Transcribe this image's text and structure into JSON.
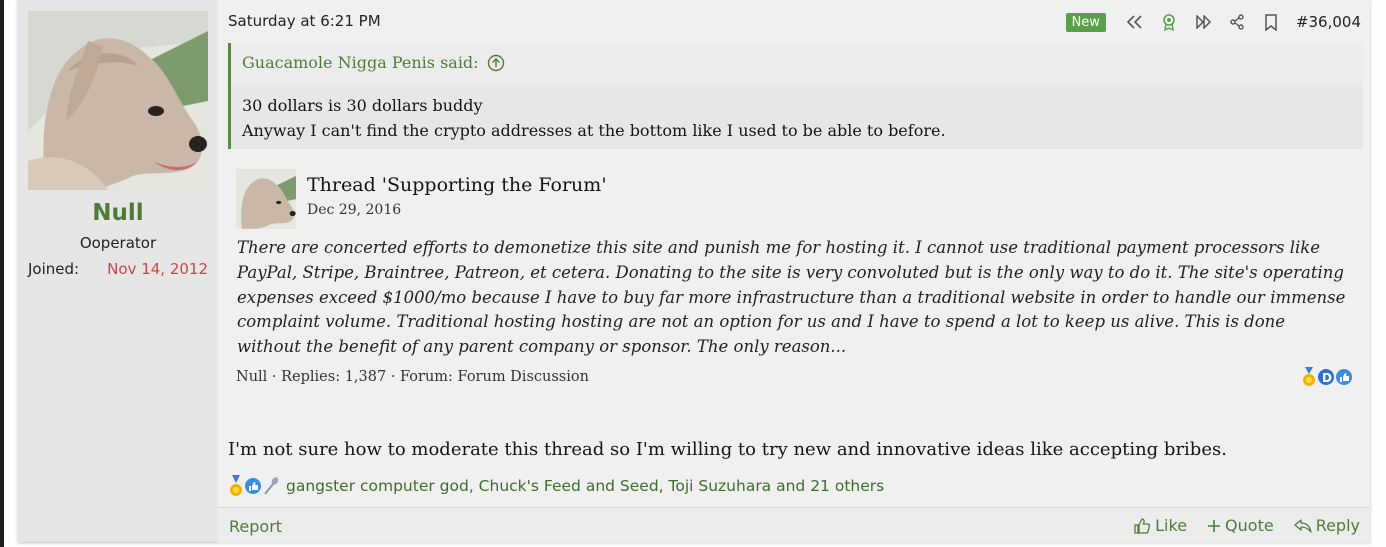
{
  "post": {
    "user": {
      "name": "Null",
      "title": "Ooperator",
      "joined_label": "Joined:",
      "joined_value": "Nov 14, 2012"
    },
    "header": {
      "date": "Saturday at 6:21 PM",
      "new_badge": "New",
      "post_number": "#36,004",
      "icons": [
        "rewind-icon",
        "award-icon",
        "fast-forward-icon",
        "share-icon",
        "bookmark-icon"
      ]
    },
    "quote": {
      "author": "Guacamole Nigga Penis said:",
      "lines": [
        "30 dollars is 30 dollars buddy",
        "Anyway I can't find the crypto addresses at the bottom like I used to be able to before."
      ]
    },
    "unfurl": {
      "title": "Thread 'Supporting the Forum'",
      "date": "Dec 29, 2016",
      "excerpt": "There are concerted efforts to demonetize this site and punish me for hosting it. I cannot use traditional payment processors like PayPal, Stripe, Braintree, Patreon, et cetera. Donating to the site is very convoluted but is the only way to do it. The site's operating expenses exceed $1000/mo because I have to buy far more infrastructure than a traditional website in order to handle our immense complaint volume. Traditional hosting hosting are not an option for us and I have to spend a lot to keep us alive. This is done without the benefit of any parent company or sponsor. The only reason...",
      "meta": "Null · Replies: 1,387 · Forum: Forum Discussion"
    },
    "message": "I'm not sure how to moderate this thread so I'm willing to try new and innovative ideas like accepting bribes.",
    "reactions_text": "gangster computer god, Chuck's Feed and Seed, Toji Suzuhara and 21 others",
    "footer": {
      "report": "Report",
      "like": "Like",
      "quote": "Quote",
      "reply": "Reply"
    }
  },
  "colors": {
    "accent_green": "#4e7c38",
    "new_badge": "#58a04a",
    "joined_date": "#cc4545",
    "quote_border": "#5c8a45"
  }
}
